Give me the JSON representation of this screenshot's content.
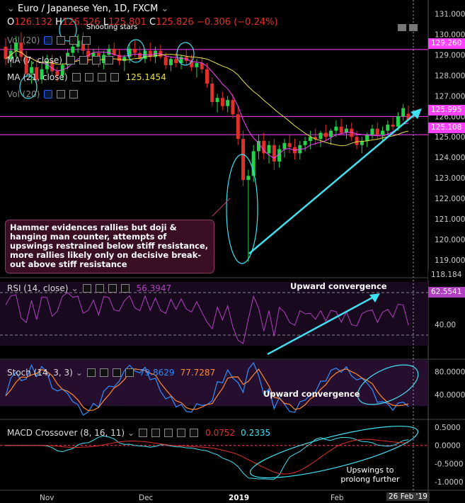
{
  "title": "Euro / Japanese Yen, 1D, FXCM",
  "ohlc": {
    "o": "126.132",
    "h": "126.526",
    "l": "125.801",
    "c": "125.826",
    "chg": "−0.306 (−0.24%)"
  },
  "labels": {
    "o": "O",
    "h": "H",
    "l": "L",
    "c": "C"
  },
  "legend": {
    "vol": "Vol (20)",
    "ma7": "MA (7, close)",
    "ma21": "MA (21, close)",
    "ma21_val": "125.1454",
    "vol2": "Vol (20)"
  },
  "annot": {
    "shooting": "Shooting stars",
    "note": "Hammer evidences rallies but doji & hanging man counter, attempts of upswings restrained below stiff resistance, more rallies likely only on decisive break-out above stiff resistance",
    "rsi_conv": "Upward convergence",
    "stoch_conv": "Upward convergence",
    "macd_note": "Upswings to prolong further"
  },
  "rsi": {
    "label": "RSI (14, close)",
    "val": "56.3947",
    "tag": "62.5541"
  },
  "stoch": {
    "label": "Stoch (14, 3, 3)",
    "k": "79.8629",
    "d": "77.7287"
  },
  "macd": {
    "label": "MACD Crossover (8, 16, 11)",
    "v1": "0.0752",
    "v2": "0.2335"
  },
  "price_tags": {
    "r1": "129.260",
    "r2": "125.995",
    "r3": "125.108",
    "bottom": "118.184"
  },
  "dates": [
    "Nov",
    "Dec",
    "2019",
    "Feb",
    "26 Feb '19"
  ],
  "colors": {
    "up": "#26d24a",
    "down": "#e0302a",
    "ma": "#ff40ff",
    "ma21": "#e8e040",
    "cyan": "#40e0f0",
    "level": "#ff40ff",
    "bg": "#000000"
  },
  "chart_data": {
    "type": "candlestick",
    "title": "Euro / Japanese Yen, 1D, FXCM",
    "price_axis": {
      "ticks": [
        131,
        130,
        129,
        128,
        127,
        126,
        125,
        124,
        123,
        122,
        121,
        120,
        119
      ],
      "range": [
        118.2,
        131.4
      ]
    },
    "rsi_axis": {
      "ticks": [
        40
      ],
      "range": [
        20,
        80
      ]
    },
    "stoch_axis": {
      "ticks": [
        80,
        40
      ],
      "range": [
        0,
        100
      ]
    },
    "macd_axis": {
      "ticks": [
        0.5,
        0.0,
        -0.5,
        -1.0
      ],
      "range": [
        -1.2,
        0.7
      ]
    },
    "x_labels": [
      "Nov",
      "Dec",
      "2019",
      "Feb",
      "26 Feb '19"
    ],
    "levels": [
      129.26,
      125.995,
      125.108
    ],
    "candles": [
      [
        129.4,
        129.8,
        128.5,
        128.8
      ],
      [
        128.8,
        129.5,
        128.4,
        129.2
      ],
      [
        129.2,
        129.9,
        128.9,
        129.6
      ],
      [
        129.6,
        130.1,
        128.7,
        128.9
      ],
      [
        128.9,
        129.2,
        127.9,
        128.1
      ],
      [
        128.1,
        128.7,
        127.6,
        128.4
      ],
      [
        128.4,
        128.8,
        127.5,
        127.8
      ],
      [
        127.8,
        128.6,
        127.6,
        128.3
      ],
      [
        128.3,
        129.0,
        128.1,
        128.7
      ],
      [
        128.7,
        129.0,
        128.0,
        128.2
      ],
      [
        128.2,
        128.4,
        127.7,
        128.0
      ],
      [
        128.0,
        128.6,
        127.8,
        128.5
      ],
      [
        128.5,
        129.3,
        128.3,
        129.1
      ],
      [
        129.1,
        129.6,
        128.8,
        129.4
      ],
      [
        129.4,
        130.0,
        129.1,
        129.7
      ],
      [
        129.7,
        130.1,
        129.0,
        129.2
      ],
      [
        129.2,
        129.5,
        128.6,
        128.9
      ],
      [
        128.9,
        129.3,
        128.5,
        129.1
      ],
      [
        129.1,
        129.4,
        128.4,
        128.6
      ],
      [
        128.6,
        129.2,
        128.3,
        129.0
      ],
      [
        129.0,
        129.5,
        128.7,
        129.3
      ],
      [
        129.3,
        129.6,
        128.9,
        129.0
      ],
      [
        129.0,
        129.3,
        128.5,
        128.7
      ],
      [
        128.7,
        129.0,
        128.2,
        128.9
      ],
      [
        128.9,
        129.5,
        128.6,
        129.3
      ],
      [
        129.3,
        129.7,
        128.9,
        129.1
      ],
      [
        129.1,
        129.4,
        128.7,
        128.8
      ],
      [
        128.8,
        129.3,
        128.6,
        129.2
      ],
      [
        129.2,
        129.6,
        128.7,
        128.9
      ],
      [
        128.9,
        129.4,
        128.6,
        129.2
      ],
      [
        129.2,
        129.5,
        128.8,
        128.9
      ],
      [
        128.9,
        129.1,
        128.3,
        128.5
      ],
      [
        128.5,
        128.9,
        128.2,
        128.8
      ],
      [
        128.8,
        129.1,
        128.4,
        128.6
      ],
      [
        128.6,
        129.0,
        128.3,
        128.9
      ],
      [
        128.9,
        129.3,
        128.5,
        128.7
      ],
      [
        128.7,
        129.0,
        128.2,
        128.4
      ],
      [
        128.4,
        128.8,
        127.9,
        128.6
      ],
      [
        128.6,
        128.9,
        128.1,
        128.3
      ],
      [
        128.3,
        128.6,
        127.4,
        127.6
      ],
      [
        127.6,
        127.9,
        126.5,
        126.7
      ],
      [
        126.7,
        127.1,
        126.2,
        126.9
      ],
      [
        126.9,
        127.2,
        126.3,
        126.5
      ],
      [
        126.5,
        127.0,
        126.2,
        126.8
      ],
      [
        126.8,
        127.1,
        125.9,
        126.1
      ],
      [
        126.1,
        126.5,
        124.6,
        124.9
      ],
      [
        124.9,
        125.3,
        122.6,
        122.9
      ],
      [
        122.9,
        123.4,
        118.9,
        123.1
      ],
      [
        123.1,
        124.6,
        122.8,
        124.3
      ],
      [
        124.3,
        125.1,
        123.9,
        124.8
      ],
      [
        124.8,
        125.2,
        123.9,
        124.2
      ],
      [
        124.2,
        124.8,
        123.7,
        124.6
      ],
      [
        124.6,
        124.9,
        123.4,
        123.8
      ],
      [
        123.8,
        124.6,
        123.5,
        124.4
      ],
      [
        124.4,
        124.9,
        124.0,
        124.7
      ],
      [
        124.7,
        125.1,
        124.2,
        124.5
      ],
      [
        124.5,
        124.9,
        123.9,
        124.2
      ],
      [
        124.2,
        124.8,
        123.9,
        124.6
      ],
      [
        124.6,
        125.0,
        124.3,
        124.8
      ],
      [
        124.8,
        125.3,
        124.4,
        125.0
      ],
      [
        125.0,
        125.4,
        124.6,
        124.9
      ],
      [
        124.9,
        125.3,
        124.5,
        125.2
      ],
      [
        125.2,
        125.6,
        124.8,
        125.0
      ],
      [
        125.0,
        125.4,
        124.6,
        125.3
      ],
      [
        125.3,
        125.8,
        125.0,
        125.5
      ],
      [
        125.5,
        125.9,
        125.1,
        125.2
      ],
      [
        125.2,
        125.6,
        124.9,
        125.4
      ],
      [
        125.4,
        125.7,
        124.8,
        125.0
      ],
      [
        125.0,
        125.3,
        124.4,
        124.6
      ],
      [
        124.6,
        125.0,
        124.2,
        124.8
      ],
      [
        124.8,
        125.2,
        124.5,
        125.1
      ],
      [
        125.1,
        125.6,
        124.9,
        125.4
      ],
      [
        125.4,
        125.7,
        124.9,
        125.1
      ],
      [
        125.1,
        125.5,
        124.8,
        125.3
      ],
      [
        125.3,
        125.8,
        125.1,
        125.6
      ],
      [
        125.6,
        126.0,
        125.3,
        125.5
      ],
      [
        125.5,
        126.2,
        125.3,
        126.0
      ],
      [
        126.0,
        126.6,
        125.8,
        126.4
      ],
      [
        126.132,
        126.526,
        125.801,
        125.826
      ]
    ]
  }
}
